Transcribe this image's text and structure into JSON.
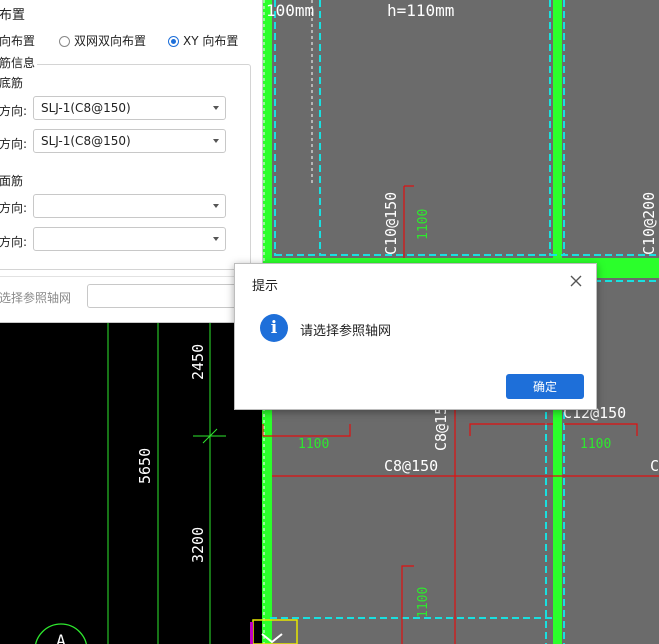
{
  "panel": {
    "layout_title": "布置",
    "radio_options": [
      {
        "label": "向布置",
        "selected": false
      },
      {
        "label": "双网双向布置",
        "selected": false
      },
      {
        "label": "XY 向布置",
        "selected": true
      }
    ],
    "group_title": "筋信息",
    "bottom_rebar_label": "底筋",
    "direction_label": "方向:",
    "bottom_x_value": "SLJ-1(C8@150)",
    "bottom_y_value": "SLJ-1(C8@150)",
    "top_rebar_label": "面筋",
    "top_x_value": "",
    "top_y_value": "",
    "axis_prompt_label": "选择参照轴网",
    "axis_input_value": ""
  },
  "cad": {
    "top_texts": [
      "100mm",
      "h=110mm"
    ],
    "slab_labels": [
      "C10@150",
      "C10@200",
      "C8@150",
      "C12@150",
      "C8@150",
      "C"
    ],
    "dim_labels": [
      "5650",
      "2450",
      "3200"
    ],
    "rebar_marks": [
      "1100",
      "1100",
      "1100",
      "1100"
    ],
    "axis_bubble": "A",
    "colors": {
      "slab": "#6b6b6b",
      "beam": "#2bff2b",
      "cyan": "#19e0e0",
      "red": "#e01010",
      "dim": "#2ee82e"
    }
  },
  "dialog": {
    "title": "提示",
    "message": "请选择参照轴网",
    "ok_label": "确定",
    "icon": "info-icon",
    "close_icon": "close-icon"
  }
}
